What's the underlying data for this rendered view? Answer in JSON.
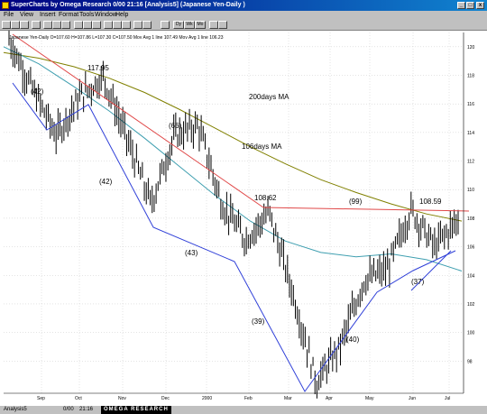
{
  "window": {
    "title": "SuperCharts by Omega Research 0/00 21:16 [Analysis5] (Japanese Yen-Daily )",
    "min_label": "_",
    "max_label": "□",
    "close_label": "x"
  },
  "menu": {
    "items": [
      "File",
      "View",
      "Insert",
      "Format",
      "Tools",
      "Window",
      "Help"
    ]
  },
  "toolbar": {
    "buttons": [
      "Dy",
      "Wk",
      "Mo"
    ]
  },
  "chart": {
    "legend": "Japanese Yen-Daily  O=107.60 H=107.86 L=107.30 C=107.50  Mov Avg 1 line 107.49  Mov Avg 1 line 106.23",
    "annotations": {
      "ma200": "200days MA",
      "ma106": "106days MA",
      "p117": "117.95",
      "p108a": "108.62",
      "p108b": "108.59",
      "c42a": "(42)",
      "c42b": "(42)",
      "c66": "(66)",
      "c43": "(43)",
      "c99": "(99)",
      "c39": "(39)",
      "c40": "(40)",
      "c37": "(37)"
    },
    "colors": {
      "price": "#000000",
      "ma200": "#808000",
      "ma106": "#3f9fb0",
      "trend_red": "#e04848",
      "trend_blue": "#3040d8",
      "grid": "#c8c8c8"
    }
  },
  "chart_data": {
    "type": "line",
    "title": "",
    "xlabel": "",
    "ylabel": "",
    "x_ticks": [
      "Sep",
      "Oct",
      "Nov",
      "Dec",
      "2000",
      "Feb",
      "Mar",
      "Apr",
      "May",
      "Jun",
      "Jul"
    ],
    "y_ticks": [
      98,
      100,
      102,
      104,
      106,
      108,
      110,
      112,
      114,
      116,
      118,
      120
    ],
    "ylim": [
      96,
      121
    ],
    "series": [
      {
        "name": "200days MA",
        "values": [
          119.6,
          119.2,
          118.6,
          117.8,
          116.8,
          115.6,
          114.3,
          113.0,
          111.8,
          110.7,
          109.8,
          109.0,
          108.3,
          107.8
        ]
      },
      {
        "name": "106days MA",
        "values": [
          120.0,
          118.8,
          117.2,
          115.5,
          113.6,
          111.6,
          109.6,
          107.8,
          106.4,
          105.6,
          105.3,
          105.5,
          105.1,
          104.3
        ]
      }
    ],
    "price_path": [
      120.5,
      117.0,
      113.8,
      116.5,
      117.9,
      113.5,
      109.0,
      113.8,
      114.5,
      109.0,
      106.5,
      108.4,
      102.8,
      96.5,
      99.0,
      103.6,
      104.4,
      108.6,
      106.0,
      107.9
    ],
    "price_segments": 20
  },
  "status": {
    "left": "Analysis5",
    "date": "0/00",
    "time": "21:16",
    "brand": "OMEGA RESEARCH"
  }
}
